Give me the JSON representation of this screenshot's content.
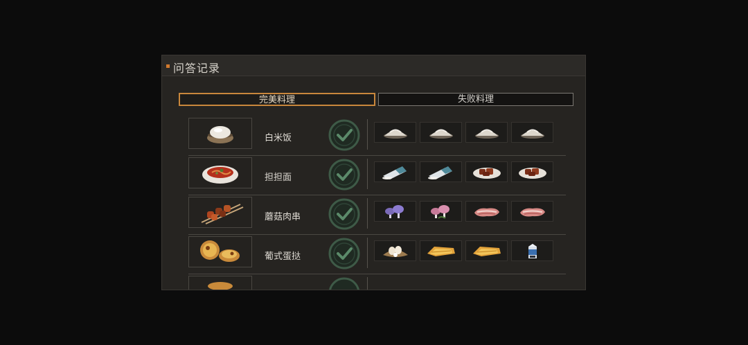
{
  "window": {
    "title": "问答记录",
    "accent": "#d27a2e"
  },
  "tabs": [
    {
      "label": "完美料理",
      "active": true
    },
    {
      "label": "失败料理",
      "active": false
    }
  ],
  "records": [
    {
      "dish": "白米饭",
      "dish_icon": "rice-bowl-icon",
      "status": "correct",
      "ingredients": [
        "rice-grain-icon",
        "rice-grain-icon",
        "rice-grain-icon",
        "rice-grain-icon"
      ]
    },
    {
      "dish": "担担面",
      "dish_icon": "noodle-bowl-icon",
      "status": "correct",
      "ingredients": [
        "flour-bag-icon",
        "flour-bag-icon",
        "braised-meat-icon",
        "braised-meat-icon"
      ]
    },
    {
      "dish": "蘑菇肉串",
      "dish_icon": "kebab-skewer-icon",
      "status": "correct",
      "ingredients": [
        "purple-mushroom-icon",
        "pink-mushroom-icon",
        "raw-meat-icon",
        "raw-meat-icon"
      ]
    },
    {
      "dish": "葡式蛋挞",
      "dish_icon": "egg-tart-icon",
      "status": "correct",
      "ingredients": [
        "eggs-nest-icon",
        "pastry-icon",
        "pastry-icon",
        "milk-carton-icon"
      ]
    }
  ]
}
